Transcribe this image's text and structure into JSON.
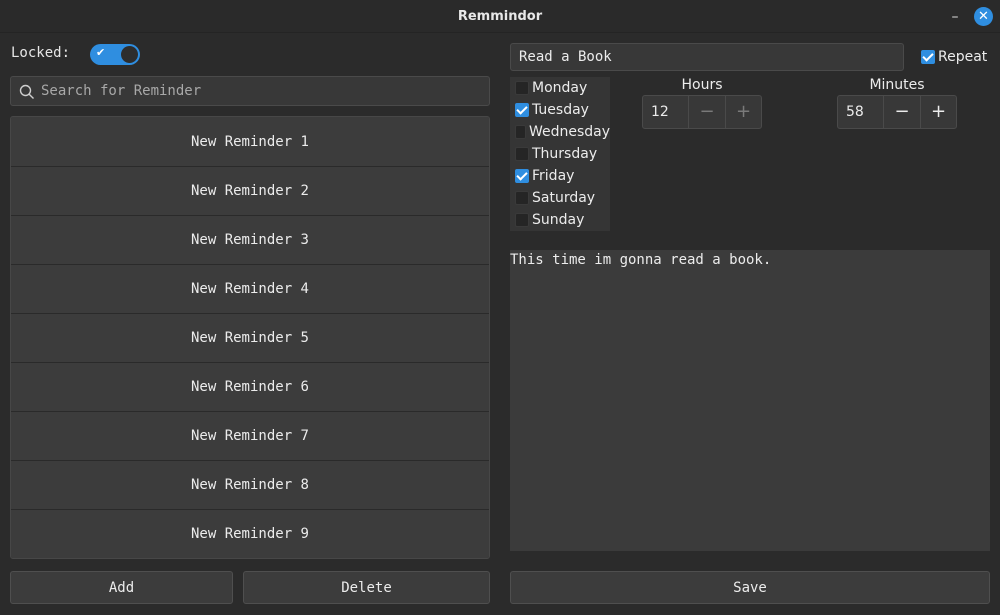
{
  "window": {
    "title": "Remmindor",
    "minimize_glyph": "–",
    "close_glyph": "✕"
  },
  "lock": {
    "label": "Locked:",
    "enabled": true
  },
  "search": {
    "placeholder": "Search for Reminder",
    "value": ""
  },
  "reminders": [
    "New Reminder 1",
    "New Reminder 2",
    "New Reminder 3",
    "New Reminder 4",
    "New Reminder 5",
    "New Reminder 6",
    "New Reminder 7",
    "New Reminder 8",
    "New Reminder 9"
  ],
  "actions": {
    "add_label": "Add",
    "delete_label": "Delete",
    "save_label": "Save"
  },
  "editor": {
    "name_value": "Read a Book",
    "repeat_label": "Repeat",
    "repeat_checked": true,
    "days": [
      {
        "label": "Monday",
        "checked": false
      },
      {
        "label": "Tuesday",
        "checked": true
      },
      {
        "label": "Wednesday",
        "checked": false
      },
      {
        "label": "Thursday",
        "checked": false
      },
      {
        "label": "Friday",
        "checked": true
      },
      {
        "label": "Saturday",
        "checked": false
      },
      {
        "label": "Sunday",
        "checked": false
      }
    ],
    "hours": {
      "label": "Hours",
      "value": "12"
    },
    "minutes": {
      "label": "Minutes",
      "value": "58"
    },
    "note": "This time im gonna read a book."
  },
  "colors": {
    "accent": "#2f8ee0",
    "background": "#2b2b2b"
  }
}
